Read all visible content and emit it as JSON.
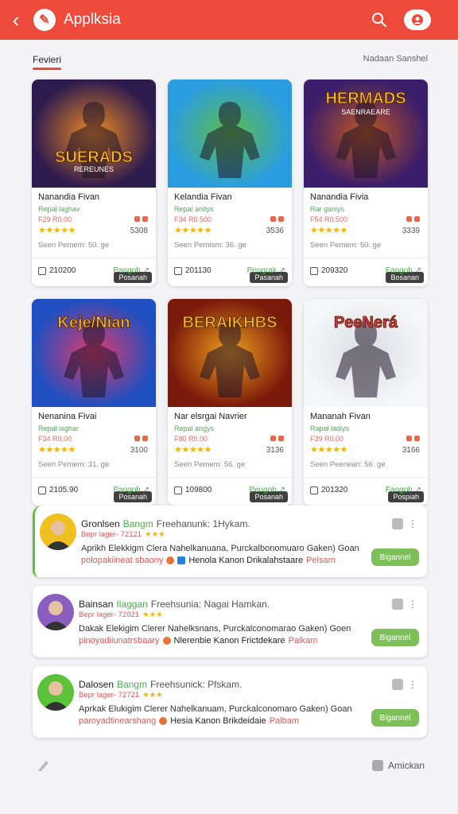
{
  "header": {
    "title": "Applksia",
    "logo_glyph": "✎",
    "back_glyph": "‹",
    "accent": "#ee4a3b"
  },
  "tabs": {
    "active": "Fevieri",
    "right": "Nadaan Sanshel"
  },
  "cards": [
    {
      "art_title": "SUERADS",
      "art_sub": "REREUNES",
      "tag": "Posanah",
      "name": "Nanandia Fivan",
      "sub": "Repal laghav",
      "price": "F29 R0.00",
      "stars": "★★★★★",
      "count": "5308",
      "meta": "Seen Pemem:  50. ge",
      "id": "210200",
      "link": "Pangoh ↗",
      "bg1": "#2d1b4e",
      "bg2": "#f08a24"
    },
    {
      "art_title": "",
      "art_sub": "",
      "tag": "Pasanah",
      "name": "Kelandia Fivan",
      "sub": "Repal anitys",
      "price": "F34 R0.500",
      "stars": "★★★★★",
      "count": "3536",
      "meta": "Seen Pemism:  36. ge",
      "id": "201130",
      "link": "Pengrak ↗",
      "bg1": "#2a9de0",
      "bg2": "#5fbd4a"
    },
    {
      "art_title": "HERMADS",
      "art_sub": "SAENRAEARE",
      "tag": "Bosanan",
      "name": "Nanandia Fivia",
      "sub": "Rar ganiys",
      "price": "F54 R0.500",
      "stars": "★★★★★",
      "count": "3339",
      "meta": "Seen Pemem:  50. ge",
      "id": "209320",
      "link": "Fangoh ↗",
      "bg1": "#3a1d6b",
      "bg2": "#c2571f"
    },
    {
      "art_title": "Keje/Nian",
      "art_sub": "",
      "tag": "Posanah",
      "name": "Nenanina Fivai",
      "sub": "Repal laghar",
      "price": "F34 R0.00",
      "stars": "★★★★★",
      "count": "3100",
      "meta": "Seen Pemem:  31. ge",
      "id": "2105.90",
      "link": "Pangoh ↗",
      "bg1": "#1f4fc0",
      "bg2": "#e23b6b"
    },
    {
      "art_title": "BERAIKHBS",
      "art_sub": "",
      "tag": "Posanah",
      "name": "Nar elsrgai Navrier",
      "sub": "Repal angys",
      "price": "F80 R0.00",
      "stars": "★★★★★",
      "count": "3136",
      "meta": "Seen Pemem:  56. ge",
      "id": "109800",
      "link": "Pengoh ↗",
      "bg1": "#7a1a0a",
      "bg2": "#f0a020"
    },
    {
      "art_title": "PeeNerá",
      "art_sub": "",
      "tag": "Pospiah",
      "name": "Mananah Fivan",
      "sub": "Rapal ladiys",
      "price": "F39 R0.00",
      "stars": "★★★★★",
      "count": "3166",
      "meta": "Seen Peenean:  56. ge",
      "id": "201320",
      "link": "Fangoh ↗",
      "bg1": "#f5f6f8",
      "bg2": "#d9dde3"
    }
  ],
  "reviews": [
    {
      "name": "Gronlsen",
      "tag": "Bangm",
      "title": "Freehanunk: 1Hykam.",
      "date": "Bepr lager- 72121",
      "stars": "★★★",
      "body": "Aprikh Elekkigm Clera Nahelkanuana, Purckalbonomuaro Gaken) Goan",
      "foot_a": "polopakiineat sbaony",
      "foot_b": "Henola Kanon Drikalahstaare",
      "foot_c": "Pelsam",
      "button": "Bigannel",
      "avatar_bg": "#f0c020"
    },
    {
      "name": "Bainsan",
      "tag": "Ilaggan",
      "title": "Freehsunia: Nagai Hamkan.",
      "date": "Bepr lager- 72021",
      "stars": "★★★",
      "body": "Dakak Elekigim Clerer Nahelksnans, Purckalconomarao Gaken) Goen",
      "foot_a": "pinoyadiiunatrsbaary",
      "foot_b": "Nlerenbie Kanon Frictdekare",
      "foot_c": "Palkam",
      "button": "Bigannel",
      "avatar_bg": "#8b5fbf"
    },
    {
      "name": "Dalosen",
      "tag": "Bangm",
      "title": "Freehsunick: Pfskam.",
      "date": "Bepr lager- 72721",
      "stars": "★★★",
      "body": "Aprkak Elukigim Clerer Nahelkanuam, Purckalconomaro Gaken) Goan",
      "foot_a": "paroyadtinearshang",
      "foot_b": "Hesia Kanon Brikdeidaie",
      "foot_c": "Palbam",
      "button": "Bigannel",
      "avatar_bg": "#5cc23a"
    }
  ],
  "bottombar": {
    "right": "Amickan"
  }
}
